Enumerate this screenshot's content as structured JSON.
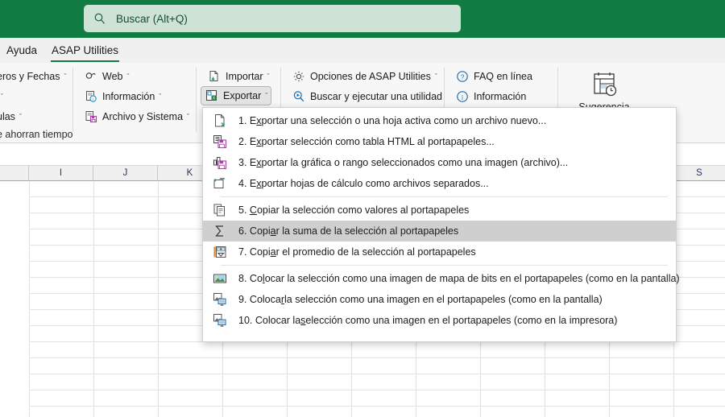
{
  "titlebar": {
    "search": {
      "placeholder": "Buscar (Alt+Q)",
      "icon": "search-icon"
    },
    "bg_color": "#107c41"
  },
  "tabs": [
    {
      "label": "Ayuda",
      "active": false
    },
    {
      "label": "ASAP Utilities",
      "active": true
    }
  ],
  "ribbon": {
    "group1": [
      {
        "label": "eros y Fechas",
        "caret": "ˇ",
        "icon": "numbers-dates-icon",
        "truncated": true
      },
      {
        "label": "",
        "caret": "ˇ",
        "icon": "group-icon",
        "truncated": true
      },
      {
        "label": "ulas",
        "caret": "ˇ",
        "icon": "formulas-icon",
        "truncated": true
      }
    ],
    "hint": "e ahorran tiempo",
    "group2": [
      {
        "label": "Web",
        "caret": "ˇ",
        "icon": "web-icon"
      },
      {
        "label": "Información",
        "caret": "ˇ",
        "icon": "information-icon"
      },
      {
        "label": "Archivo y Sistema",
        "caret": "ˇ",
        "icon": "file-system-icon"
      }
    ],
    "group3": [
      {
        "label": "Importar",
        "caret": "ˇ",
        "icon": "import-icon",
        "pressed": false
      },
      {
        "label": "Exportar",
        "caret": "ˇ",
        "icon": "export-icon",
        "pressed": true
      }
    ],
    "group4": [
      {
        "label": "Opciones de ASAP Utilities",
        "caret": "ˇ",
        "icon": "gear-icon"
      },
      {
        "label": "Buscar y ejecutar una utilidad",
        "caret": "",
        "icon": "run-utility-icon"
      }
    ],
    "group5": [
      {
        "label": "FAQ en línea",
        "caret": "",
        "icon": "question-circle-icon"
      },
      {
        "label": "Información",
        "caret": "",
        "icon": "info-circle-icon"
      }
    ],
    "group6": {
      "label": "Sugerencia",
      "icon": "tip-calendar-clock-icon"
    }
  },
  "export_menu": {
    "items": [
      {
        "num": "1.",
        "pre": "E",
        "acc": "x",
        "post": "portar una selección o una hoja activa como un archivo nuevo...",
        "icon": "export-file-icon",
        "highlighted": false,
        "sep_after": false
      },
      {
        "num": "2.",
        "pre": "E",
        "acc": "x",
        "post": "portar selección como tabla HTML al portapapeles...",
        "icon": "export-html-icon",
        "highlighted": false,
        "sep_after": false
      },
      {
        "num": "3.",
        "pre": "E",
        "acc": "x",
        "post": "portar la gráfica o rango seleccionados como una imagen (archivo)...",
        "icon": "export-chart-icon",
        "highlighted": false,
        "sep_after": false
      },
      {
        "num": "4.",
        "pre": "E",
        "acc": "x",
        "post": "portar hojas de cálculo como archivos separados...",
        "icon": "export-sheets-icon",
        "highlighted": false,
        "sep_after": true
      },
      {
        "num": "5.",
        "pre": "",
        "acc": "C",
        "post": "opiar la selección como valores al portapapeles",
        "icon": "copy-values-icon",
        "highlighted": false,
        "sep_after": false
      },
      {
        "num": "6.",
        "pre": "Copi",
        "acc": "a",
        "post": "r la suma de la selección al portapapeles",
        "icon": "sum-sigma-icon",
        "highlighted": true,
        "sep_after": false
      },
      {
        "num": "7.",
        "pre": "Copi",
        "acc": "a",
        "post": "r el promedio de la selección al portapapeles",
        "icon": "average-icon",
        "highlighted": false,
        "sep_after": true
      },
      {
        "num": "8.",
        "pre": "Co",
        "acc": "l",
        "post": "ocar la selección como una imagen de mapa de bits en el portapapeles (como en la pantalla)",
        "icon": "bitmap-image-icon",
        "highlighted": false,
        "sep_after": false
      },
      {
        "num": "9.",
        "pre": "Coloca",
        "acc": "r",
        "post": " la selección como una imagen en el portapapeles (como en la pantalla)",
        "icon": "picture-screen-icon",
        "highlighted": false,
        "sep_after": false
      },
      {
        "num": "10.",
        "pre": "Colocar la ",
        "acc": "s",
        "post": "elección como una imagen en el portapapeles (como en la impresora)",
        "icon": "picture-printer-icon",
        "highlighted": false,
        "sep_after": false
      }
    ],
    "highlight_color": "#cfcfcf"
  },
  "sheet": {
    "column_headers": [
      "I",
      "J",
      "K",
      "S"
    ],
    "column_header_color": "#28346b",
    "grid_line_color": "#e0e0e0"
  }
}
